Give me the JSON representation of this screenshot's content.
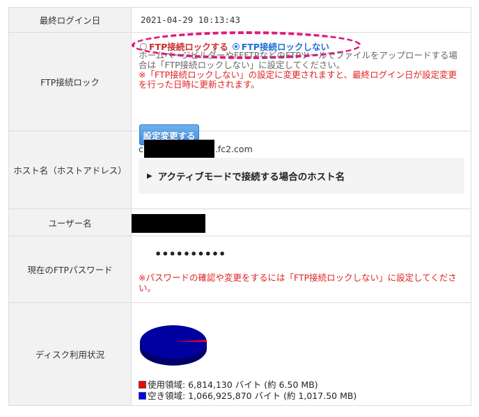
{
  "rows": {
    "last_login": {
      "label": "最終ログイン日",
      "value": "2021-04-29 10:13:43"
    },
    "ftp_lock": {
      "label": "FTP接続ロック",
      "radio_lock": "FTP接続ロックする",
      "radio_unlock": "FTP接続ロックしない",
      "selected": "unlock",
      "note_gray": "ホームページビルダーやFFFTPなどのFTPツールでファイルをアップロードする場合は「FTP接続ロックしない」に設定してください。",
      "note_red": "※「FTP接続ロックしない」の設定に変更されますと、最終ログイン日が設定変更を行った日時に更新されます。",
      "button": "設定変更する"
    },
    "host": {
      "label": "ホスト名（ホストアドレス）",
      "prefix": "c",
      "suffix": ".fc2.com",
      "accordion": "アクティブモードで接続する場合のホスト名"
    },
    "user": {
      "label": "ユーザー名"
    },
    "password": {
      "label": "現在のFTPパスワード",
      "mask": "••••••••••",
      "note": "※パスワードの確認や変更をするには「FTP接続ロックしない」に設定してください。"
    },
    "disk": {
      "label": "ディスク利用状況",
      "used_label": "使用領域: 6,814,130 バイト (約 6.50 MB)",
      "free_label": "空き領域: 1,066,925,870 バイト (約 1,017.50 MB)",
      "used_fraction": 0.0063,
      "used_color": "#ff0000",
      "free_color": "#0000a0"
    }
  },
  "colors": {
    "label_bg": "#f2f2f2",
    "border": "#dcdcdc",
    "highlight": "#e0197f",
    "button_blue": "#3b8be0",
    "warning_red": "#e02020"
  }
}
